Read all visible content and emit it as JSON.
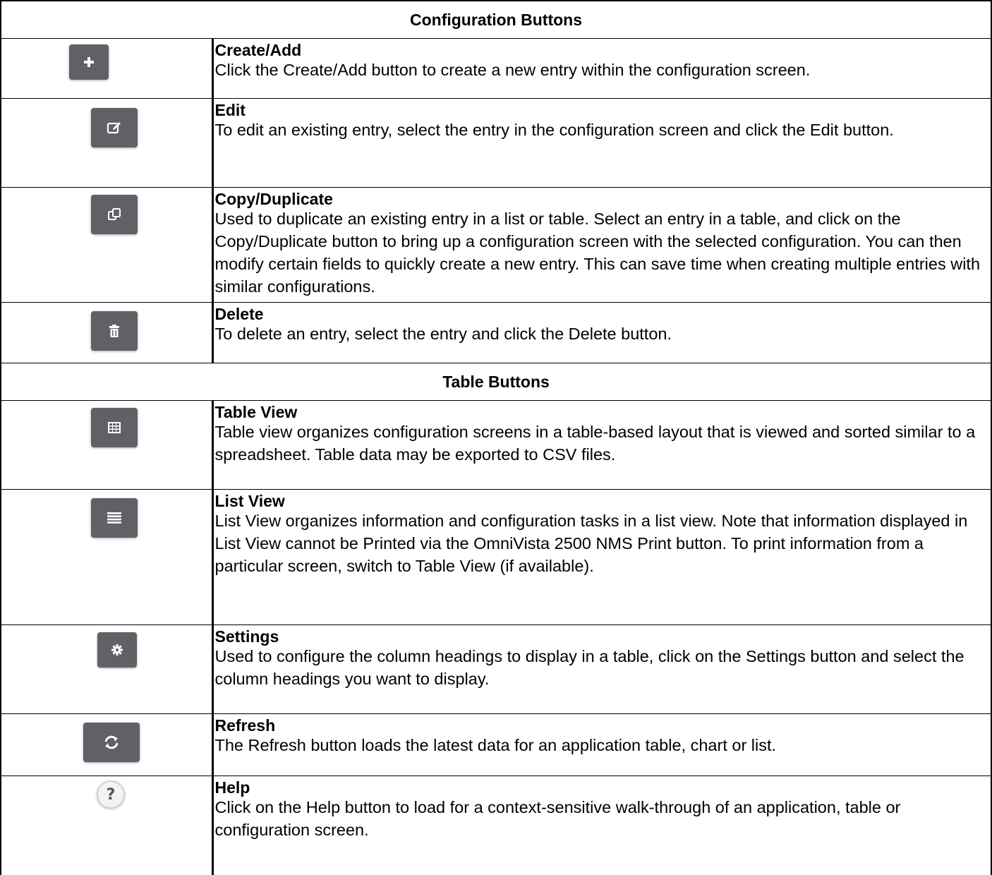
{
  "sections": {
    "configuration": "Configuration Buttons",
    "table": "Table Buttons"
  },
  "rows": [
    {
      "icon": "plus-icon",
      "title": "Create/Add",
      "text": "Click the Create/Add button to create a new entry within the configuration screen."
    },
    {
      "icon": "edit-icon",
      "title": "Edit",
      "text": "To edit an existing entry, select the entry in the configuration screen and click the Edit button."
    },
    {
      "icon": "copy-icon",
      "title": "Copy/Duplicate",
      "text": "Used to duplicate an existing entry in a list or table. Select an entry in a table, and click on the Copy/Duplicate button to bring up a configuration screen with the selected configuration. You can then modify certain fields to quickly create a new entry. This can save time when creating multiple entries with similar configurations."
    },
    {
      "icon": "trash-icon",
      "title": "Delete",
      "text": "To delete an entry, select the entry and click the Delete button."
    },
    {
      "icon": "table-icon",
      "title": "Table View",
      "text": "Table view organizes configuration screens in a table-based layout that is viewed and sorted similar to a spreadsheet. Table data may be exported to CSV files."
    },
    {
      "icon": "list-icon",
      "title": "List View",
      "text": "List View organizes information and configuration tasks in a list view. Note that information displayed in List View cannot be Printed via the OmniVista 2500 NMS Print button. To print information from a particular screen, switch to Table View (if available)."
    },
    {
      "icon": "gear-icon",
      "title": "Settings",
      "text": "Used to configure the column headings to display in a table, click on the Settings button and select the column headings you want to display."
    },
    {
      "icon": "refresh-icon",
      "title": "Refresh",
      "text": "The Refresh button loads the latest data for an application table, chart or list."
    },
    {
      "icon": "help-icon",
      "title": "Help",
      "text": "Click on the Help button to load for a context-sensitive walk-through of an application, table or configuration screen."
    }
  ],
  "help_glyph": "?"
}
